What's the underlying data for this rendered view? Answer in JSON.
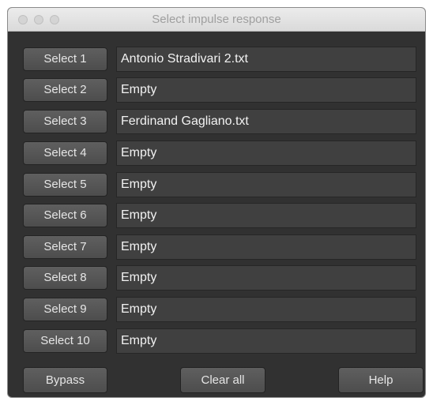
{
  "window": {
    "title": "Select impulse response"
  },
  "slots": [
    {
      "button": "Select 1",
      "file": "Antonio Stradivari 2.txt"
    },
    {
      "button": "Select 2",
      "file": "Empty"
    },
    {
      "button": "Select 3",
      "file": "Ferdinand Gagliano.txt"
    },
    {
      "button": "Select 4",
      "file": "Empty"
    },
    {
      "button": "Select 5",
      "file": "Empty"
    },
    {
      "button": "Select 6",
      "file": "Empty"
    },
    {
      "button": "Select 7",
      "file": "Empty"
    },
    {
      "button": "Select 8",
      "file": "Empty"
    },
    {
      "button": "Select 9",
      "file": "Empty"
    },
    {
      "button": "Select 10",
      "file": "Empty"
    }
  ],
  "footer": {
    "bypass": "Bypass",
    "clear_all": "Clear all",
    "help": "Help"
  }
}
